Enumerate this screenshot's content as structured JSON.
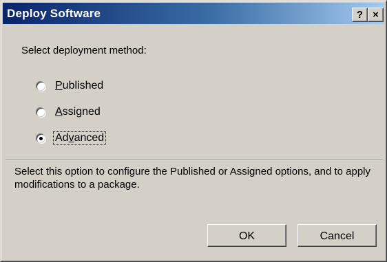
{
  "window": {
    "title": "Deploy Software",
    "help_label": "?",
    "close_label": "×"
  },
  "prompt": "Select deployment method:",
  "options": [
    {
      "mnemonic": "P",
      "rest": "ublished",
      "label": "Published",
      "selected": false
    },
    {
      "mnemonic": "A",
      "rest": "ssigned",
      "label": "Assigned",
      "selected": false
    },
    {
      "prefix": "Ad",
      "mnemonic": "v",
      "rest": "anced",
      "label": "Advanced",
      "selected": true
    }
  ],
  "description": "Select this option to configure the Published or Assigned options, and to apply modifications to a package.",
  "buttons": {
    "ok": "OK",
    "cancel": "Cancel"
  },
  "colors": {
    "face": "#d4d0c8",
    "title_start": "#0a246a",
    "title_end": "#a6caf0"
  }
}
